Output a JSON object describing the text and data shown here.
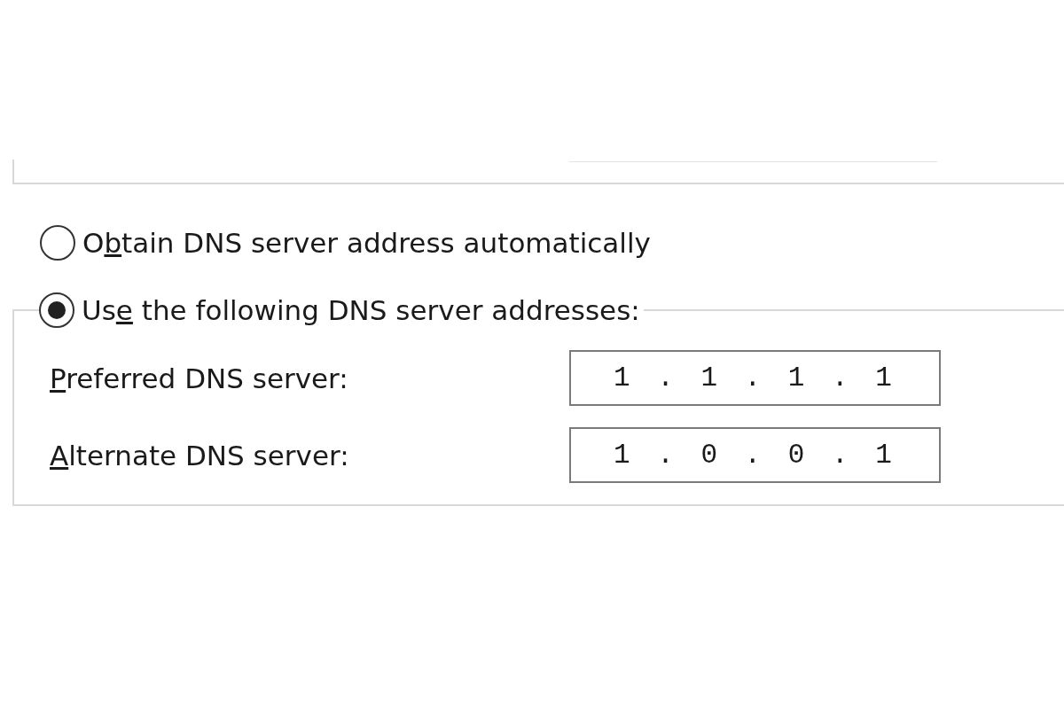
{
  "dns_options": [
    {
      "label_start": "O",
      "access_key": "b",
      "label_end": "tain DNS server address automatically",
      "selected": false
    },
    {
      "label_start": "Us",
      "access_key": "e",
      "label_end": " the following DNS server addresses:",
      "selected": true
    }
  ],
  "dns_fields": [
    {
      "access_key": "P",
      "label_end": "referred DNS server:",
      "value": "1 . 1 . 1 . 1"
    },
    {
      "access_key": "A",
      "label_end": "lternate DNS server:",
      "value": "1 . 0 . 0 . 1"
    }
  ]
}
